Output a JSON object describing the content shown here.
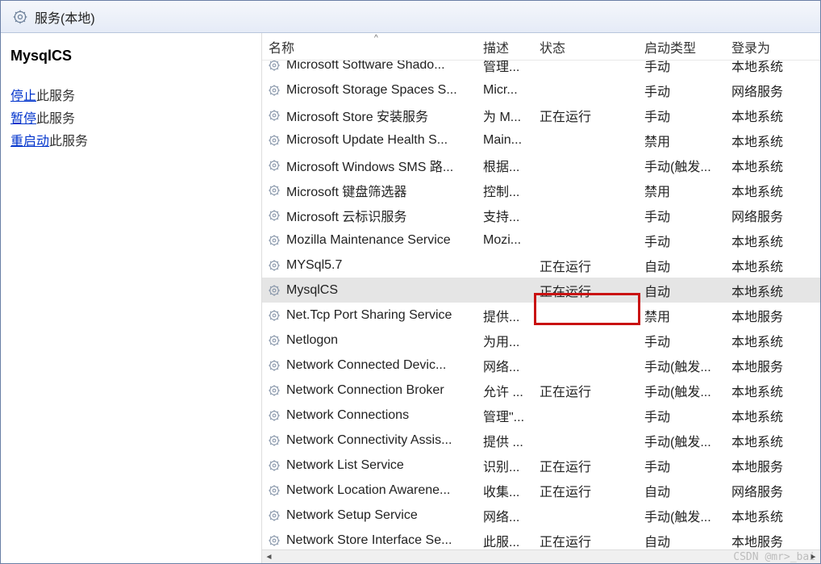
{
  "title_bar": {
    "label": "服务(本地)"
  },
  "details": {
    "service_name": "MysqlCS",
    "actions": [
      {
        "link": "停止",
        "suffix": "此服务"
      },
      {
        "link": "暂停",
        "suffix": "此服务"
      },
      {
        "link": "重启动",
        "suffix": "此服务"
      }
    ]
  },
  "columns": {
    "name": "名称",
    "desc": "描述",
    "status": "状态",
    "start_type": "启动类型",
    "logon_as": "登录为",
    "sort_caret": "^"
  },
  "services": [
    {
      "name": "Microsoft Software Shado...",
      "desc": "管理...",
      "status": "",
      "start": "手动",
      "logon": "本地系统",
      "selected": false
    },
    {
      "name": "Microsoft Storage Spaces S...",
      "desc": "Micr...",
      "status": "",
      "start": "手动",
      "logon": "网络服务",
      "selected": false
    },
    {
      "name": "Microsoft Store 安装服务",
      "desc": "为 M...",
      "status": "正在运行",
      "start": "手动",
      "logon": "本地系统",
      "selected": false
    },
    {
      "name": "Microsoft Update Health S...",
      "desc": "Main...",
      "status": "",
      "start": "禁用",
      "logon": "本地系统",
      "selected": false
    },
    {
      "name": "Microsoft Windows SMS 路...",
      "desc": "根据...",
      "status": "",
      "start": "手动(触发...",
      "logon": "本地系统",
      "selected": false
    },
    {
      "name": "Microsoft 键盘筛选器",
      "desc": "控制...",
      "status": "",
      "start": "禁用",
      "logon": "本地系统",
      "selected": false
    },
    {
      "name": "Microsoft 云标识服务",
      "desc": "支持...",
      "status": "",
      "start": "手动",
      "logon": "网络服务",
      "selected": false
    },
    {
      "name": "Mozilla Maintenance Service",
      "desc": "Mozi...",
      "status": "",
      "start": "手动",
      "logon": "本地系统",
      "selected": false
    },
    {
      "name": "MYSql5.7",
      "desc": "",
      "status": "正在运行",
      "start": "自动",
      "logon": "本地系统",
      "selected": false
    },
    {
      "name": "MysqlCS",
      "desc": "",
      "status": "正在运行",
      "start": "自动",
      "logon": "本地系统",
      "selected": true
    },
    {
      "name": "Net.Tcp Port Sharing Service",
      "desc": "提供...",
      "status": "",
      "start": "禁用",
      "logon": "本地服务",
      "selected": false
    },
    {
      "name": "Netlogon",
      "desc": "为用...",
      "status": "",
      "start": "手动",
      "logon": "本地系统",
      "selected": false
    },
    {
      "name": "Network Connected Devic...",
      "desc": "网络...",
      "status": "",
      "start": "手动(触发...",
      "logon": "本地服务",
      "selected": false
    },
    {
      "name": "Network Connection Broker",
      "desc": "允许 ...",
      "status": "正在运行",
      "start": "手动(触发...",
      "logon": "本地系统",
      "selected": false
    },
    {
      "name": "Network Connections",
      "desc": "管理\"...",
      "status": "",
      "start": "手动",
      "logon": "本地系统",
      "selected": false
    },
    {
      "name": "Network Connectivity Assis...",
      "desc": "提供 ...",
      "status": "",
      "start": "手动(触发...",
      "logon": "本地系统",
      "selected": false
    },
    {
      "name": "Network List Service",
      "desc": "识别...",
      "status": "正在运行",
      "start": "手动",
      "logon": "本地服务",
      "selected": false
    },
    {
      "name": "Network Location Awarene...",
      "desc": "收集...",
      "status": "正在运行",
      "start": "自动",
      "logon": "网络服务",
      "selected": false
    },
    {
      "name": "Network Setup Service",
      "desc": "网络...",
      "status": "",
      "start": "手动(触发...",
      "logon": "本地系统",
      "selected": false
    },
    {
      "name": "Network Store Interface Se...",
      "desc": "此服...",
      "status": "正在运行",
      "start": "自动",
      "logon": "本地服务",
      "selected": false
    }
  ],
  "watermark": "CSDN @mr>_bai"
}
